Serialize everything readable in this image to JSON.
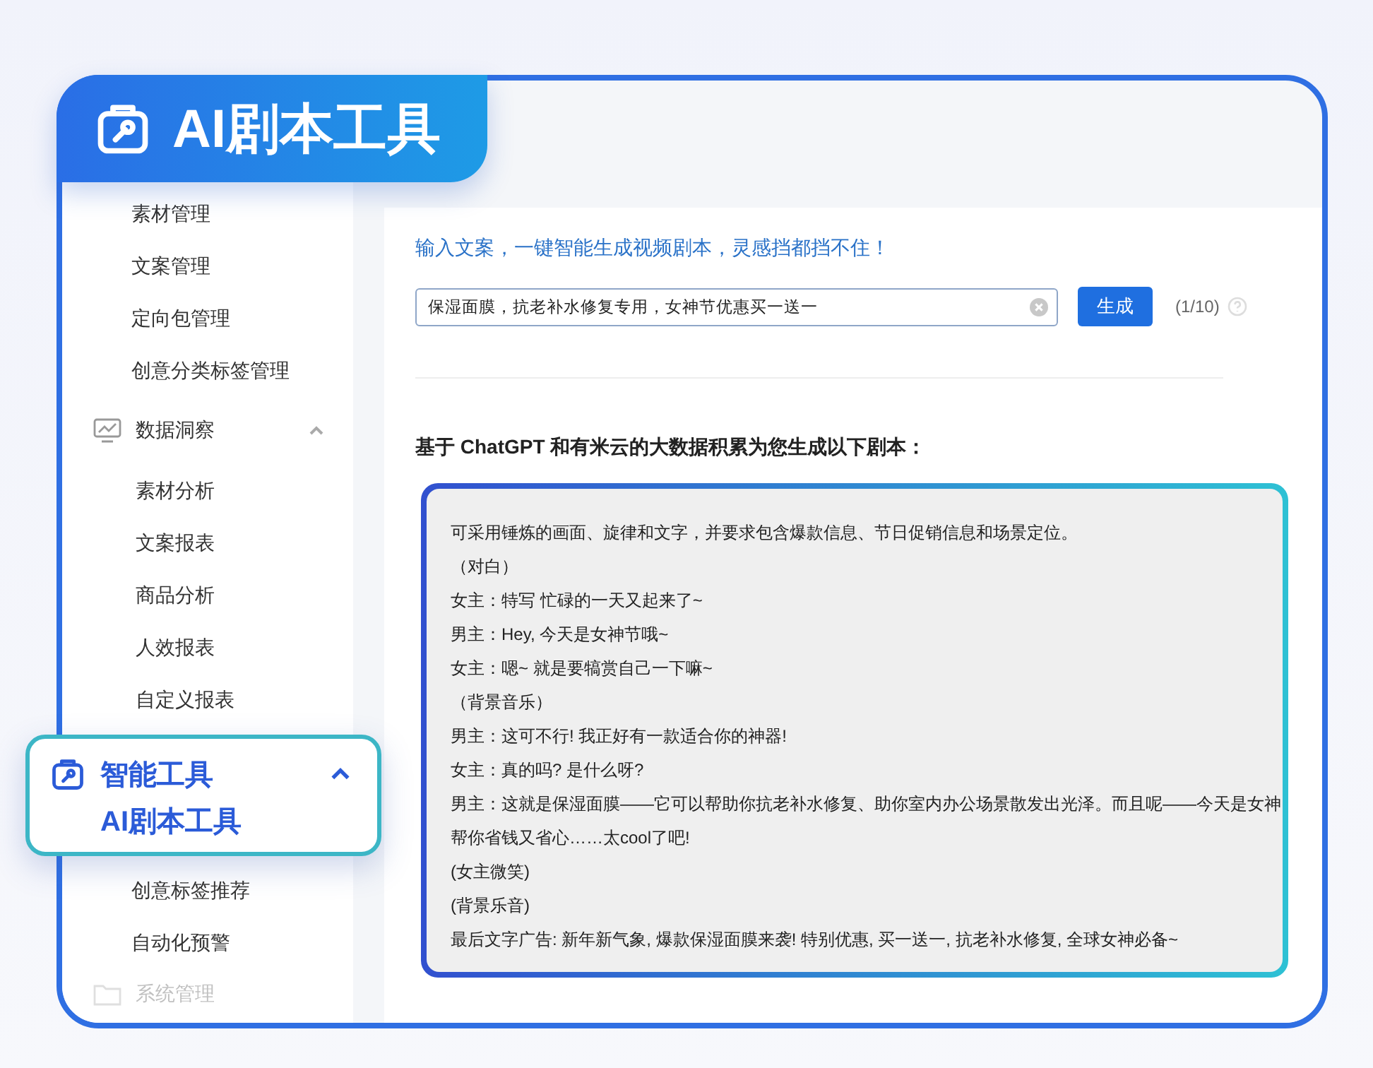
{
  "badge": {
    "title": "AI剧本工具"
  },
  "sidebar": {
    "items": [
      {
        "kind": "item",
        "label": "素材管理",
        "selected": false
      },
      {
        "kind": "item",
        "label": "文案管理",
        "selected": false
      },
      {
        "kind": "item",
        "label": "定向包管理",
        "selected": false
      },
      {
        "kind": "item",
        "label": "创意分类标签管理",
        "selected": false
      },
      {
        "kind": "group",
        "label": "数据洞察",
        "expanded": true,
        "children": [
          {
            "label": "素材分析",
            "selected": false
          },
          {
            "label": "文案报表",
            "selected": false
          },
          {
            "label": "商品分析",
            "selected": false
          },
          {
            "label": "人效报表",
            "selected": false
          },
          {
            "label": "自定义报表",
            "selected": false
          }
        ]
      },
      {
        "kind": "featured_group",
        "label": "智能工具",
        "expanded": true,
        "children": [
          {
            "label": "AI剧本工具",
            "selected": true
          }
        ]
      },
      {
        "kind": "item",
        "label": "创意标签推荐",
        "selected": false
      },
      {
        "kind": "item",
        "label": "自动化预警",
        "selected": false
      },
      {
        "kind": "faded_group",
        "label": "系统管理"
      }
    ]
  },
  "main": {
    "tagline": "输入文案，一键智能生成视频剧本，灵感挡都挡不住！",
    "input": {
      "value": "保湿面膜，抗老补水修复专用，女神节优惠买一送一"
    },
    "generate_button": "生成",
    "counter": "(1/10)",
    "result_heading": "基于 ChatGPT 和有米云的大数据积累为您生成以下剧本：",
    "script_lines": [
      "可采用锤炼的画面、旋律和文字，并要求包含爆款信息、节日促销信息和场景定位。",
      "（对白）",
      "女主：特写 忙碌的一天又起来了~",
      "男主：Hey, 今天是女神节哦~",
      "女主：嗯~ 就是要犒赏自己一下嘛~",
      "（背景音乐）",
      "男主：这可不行! 我正好有一款适合你的神器!",
      "女主：真的吗? 是什么呀?",
      "男主：这就是保湿面膜——它可以帮助你抗老补水修复、助你室内办公场景散发出光泽。而且呢——今天是女神",
      "帮你省钱又省心……太cool了吧!",
      "(女主微笑)",
      "(背景乐音)",
      "最后文字广告: 新年新气象, 爆款保湿面膜来袭! 特别优惠, 买一送一, 抗老补水修复, 全球女神必备~"
    ]
  }
}
